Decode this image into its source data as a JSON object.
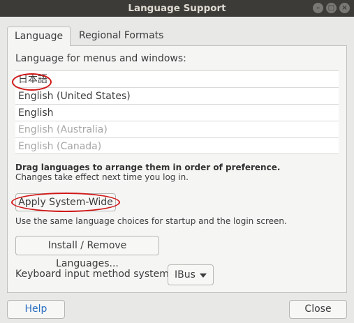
{
  "window": {
    "title": "Language Support"
  },
  "tabs": [
    {
      "label": "Language"
    },
    {
      "label": "Regional Formats"
    }
  ],
  "language": {
    "heading": "Language for menus and windows:",
    "items": [
      "日本語",
      "English (United States)",
      "English",
      "English (Australia)",
      "English (Canada)"
    ],
    "hint_bold": "Drag languages to arrange them in order of preference.",
    "hint": "Changes take effect next time you log in.",
    "apply_label": "Apply System-Wide",
    "apply_note": "Use the same language choices for startup and the login screen.",
    "install_label": "Install / Remove Languages...",
    "keyboard_label": "Keyboard input method system:",
    "keyboard_value": "IBus"
  },
  "footer": {
    "help_label": "Help",
    "close_label": "Close"
  },
  "colors": {
    "titlebar": "#3c3b37",
    "annotation_ring": "#d01818",
    "help_text": "#2a6fbf"
  },
  "icons": [
    "minimize-icon",
    "maximize-icon",
    "close-icon",
    "chevron-down-icon"
  ]
}
